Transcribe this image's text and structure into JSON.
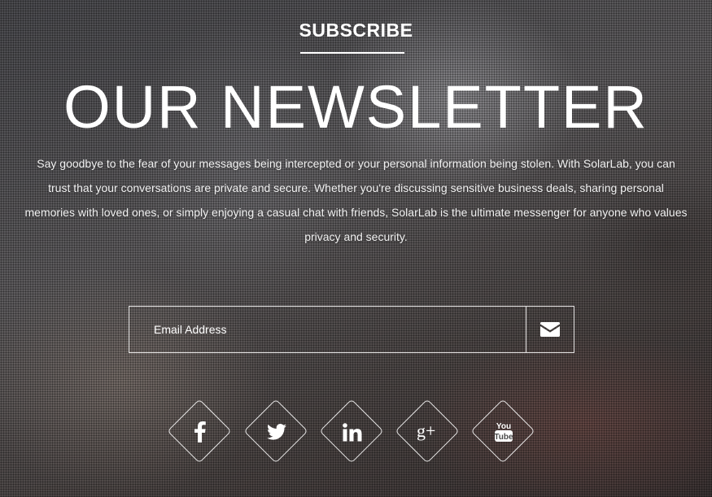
{
  "header": {
    "eyebrow": "SUBSCRIBE",
    "title": "OUR NEWSLETTER",
    "description": "Say goodbye to the fear of your messages being intercepted or your personal information being stolen. With SolarLab, you can trust that your conversations are private and secure. Whether you're discussing sensitive business deals, sharing personal memories with loved ones, or simply enjoying a casual chat with friends, SolarLab is the ultimate messenger for anyone who values privacy and security."
  },
  "form": {
    "email_placeholder": "Email Address",
    "submit_icon": "envelope-icon"
  },
  "social": [
    {
      "name": "facebook",
      "icon": "facebook-icon"
    },
    {
      "name": "twitter",
      "icon": "twitter-icon"
    },
    {
      "name": "linkedin",
      "icon": "linkedin-icon"
    },
    {
      "name": "google-plus",
      "icon": "google-plus-icon",
      "label": "g+"
    },
    {
      "name": "youtube",
      "icon": "youtube-icon",
      "label_top": "You",
      "label_bottom": "Tube"
    }
  ]
}
